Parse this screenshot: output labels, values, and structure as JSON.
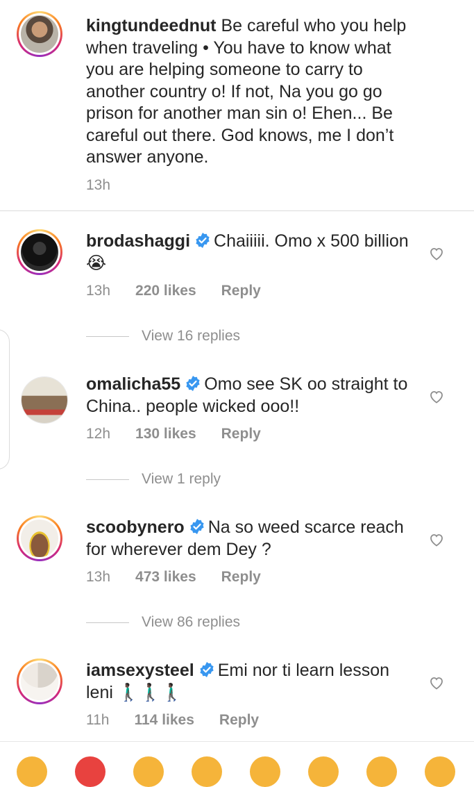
{
  "caption": {
    "username": "kingtundeednut",
    "text": "Be careful who you help when traveling • You have to know what you are helping someone to carry to another country o! If not, Na you go go prison for another man sin o! Ehen... Be careful out there. God knows, me I don’t answer anyone.",
    "time": "13h"
  },
  "comments": [
    {
      "username": "brodashaggi",
      "verified": true,
      "text": "Chaiiiii. Omo x 500 billion 😭",
      "time": "13h",
      "likes": "220 likes",
      "reply": "Reply",
      "view_replies": "View 16 replies"
    },
    {
      "username": "omalicha55",
      "verified": true,
      "text": "Omo see SK oo straight to China.. people wicked ooo!!",
      "time": "12h",
      "likes": "130 likes",
      "reply": "Reply",
      "view_replies": "View 1 reply"
    },
    {
      "username": "scoobynero",
      "verified": true,
      "text": "Na so weed scarce reach for wherever dem Dey ?",
      "time": "13h",
      "likes": "473 likes",
      "reply": "Reply",
      "view_replies": "View 86 replies"
    },
    {
      "username": "iamsexysteel",
      "verified": true,
      "text": "Emi nor ti learn lesson leni 🚶🏿‍♂️🚶🏿‍♂️🚶🏿‍♂️",
      "time": "11h",
      "likes": "114 likes",
      "reply": "Reply"
    }
  ],
  "icons": {
    "verified": "verified-badge-icon",
    "like": "heart-outline-icon"
  },
  "colors": {
    "verified": "#3897f0",
    "muted": "#8e8e8e",
    "text": "#262626"
  }
}
